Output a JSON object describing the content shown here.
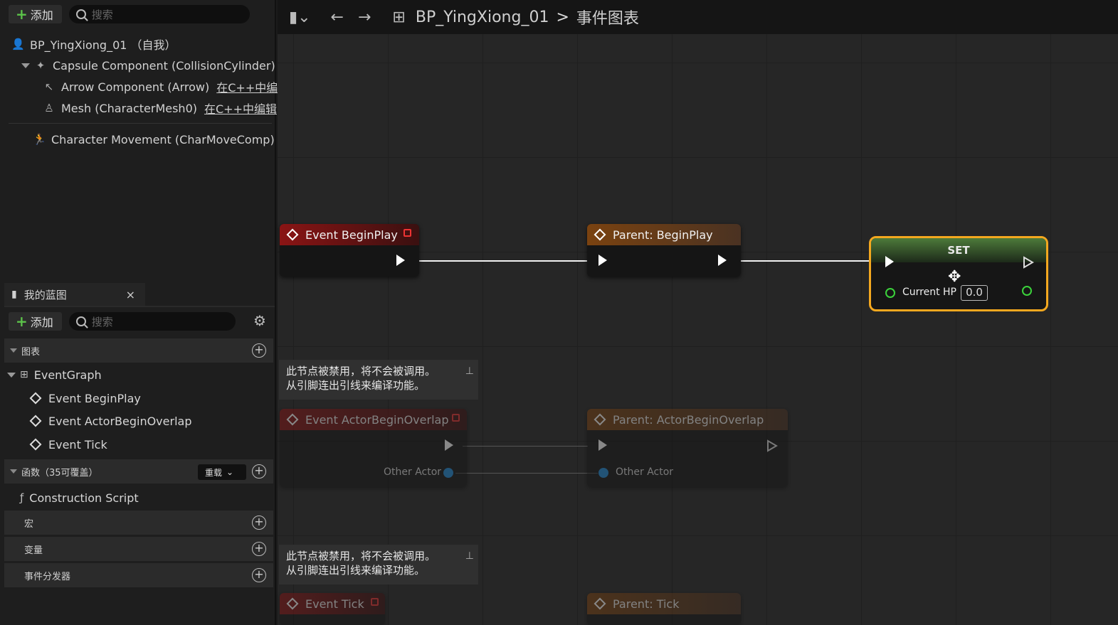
{
  "components_panel": {
    "add_label": "添加",
    "search_placeholder": "搜索",
    "items": [
      {
        "label": "BP_YingXiong_01 （自我）"
      },
      {
        "label": "Capsule Component (CollisionCylinder)"
      },
      {
        "label": "Arrow Component (Arrow)",
        "note": "在C++中编"
      },
      {
        "label": "Mesh (CharacterMesh0)",
        "note": "在C++中编辑"
      },
      {
        "label": "Character Movement (CharMoveComp)"
      }
    ]
  },
  "my_blueprint": {
    "tab_label": "我的蓝图",
    "close": "×",
    "add_label": "添加",
    "search_placeholder": "搜索",
    "sections": {
      "graphs": "图表",
      "event_graph": "EventGraph",
      "events": [
        "Event BeginPlay",
        "Event ActorBeginOverlap",
        "Event Tick"
      ],
      "functions": "函数（35可覆盖）",
      "override_label": "重载",
      "construction_script": "Construction Script",
      "macros": "宏",
      "variables": "变量",
      "dispatchers": "事件分发器"
    }
  },
  "breadcrumb": {
    "blueprint": "BP_YingXiong_01",
    "separator": ">",
    "graph": "事件图表"
  },
  "nodes": {
    "event_beginplay": "Event BeginPlay",
    "parent_beginplay": "Parent: BeginPlay",
    "set_title": "SET",
    "set_var": "Current HP",
    "set_value": "0.0",
    "event_overlap": "Event ActorBeginOverlap",
    "parent_overlap": "Parent: ActorBeginOverlap",
    "other_actor": "Other Actor",
    "event_tick": "Event Tick",
    "parent_tick": "Parent: Tick"
  },
  "comments": {
    "line1": "此节点被禁用，将不会被调用。",
    "line2": "从引脚连出引线来编译功能。"
  },
  "colors": {
    "accent_green": "#5cc34a",
    "event_red": "#8a1414",
    "function_brown": "#7a4210",
    "selection_orange": "#f4a81f",
    "float_pin": "#3bd23b",
    "object_pin": "#1e8ad8"
  }
}
